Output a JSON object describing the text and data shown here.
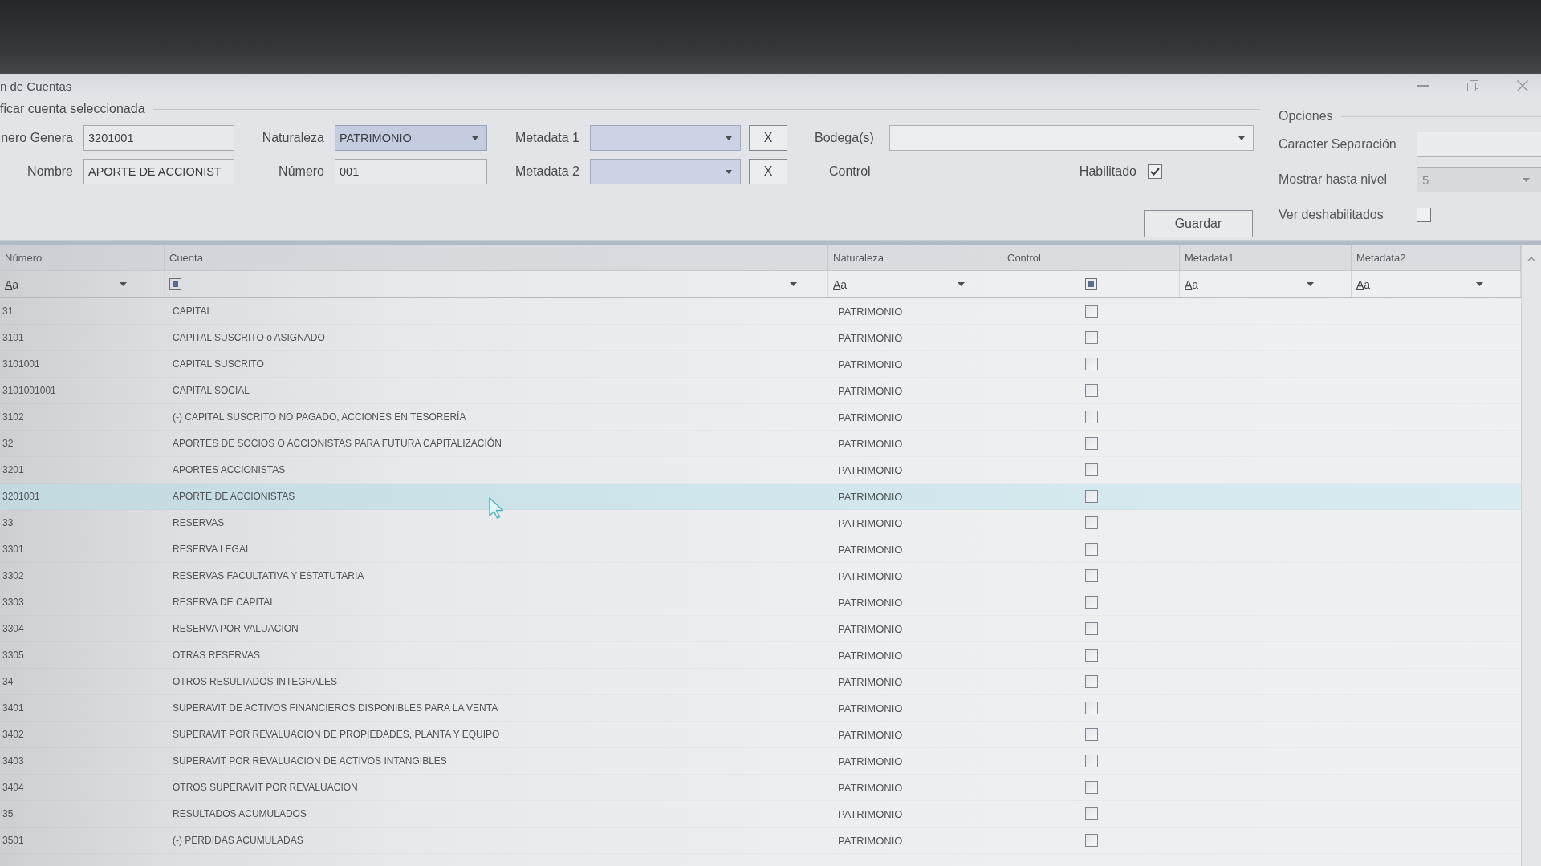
{
  "window": {
    "title": "n de Cuentas"
  },
  "form": {
    "title": "ficar cuenta seleccionada",
    "numero_general": {
      "label": "nero Genera",
      "value": "3201001"
    },
    "naturaleza": {
      "label": "Naturaleza",
      "value": "PATRIMONIO"
    },
    "metadata_1": {
      "label": "Metadata 1",
      "clear_button": "X"
    },
    "bodegas": {
      "label": "Bodega(s)"
    },
    "nombre": {
      "label": "Nombre",
      "value": "APORTE DE ACCIONIST"
    },
    "numero": {
      "label": "Número",
      "value": "001"
    },
    "metadata_2": {
      "label": "Metadata 2",
      "clear_button": "X"
    },
    "control": {
      "label": "Control"
    },
    "habilitado": {
      "label": "Habilitado",
      "checked": true
    },
    "save_button": "Guardar"
  },
  "options": {
    "title": "Opciones",
    "caracter_separacion": {
      "label": "Caracter Separación"
    },
    "mostrar_hasta_nivel": {
      "label": "Mostrar hasta nivel",
      "value": "5"
    },
    "ver_deshabilitados": {
      "label": "Ver deshabilitados",
      "checked": false
    }
  },
  "grid": {
    "columns": [
      {
        "label": "Número",
        "filter": {
          "kind": "text",
          "text": "Aa"
        }
      },
      {
        "label": "Cuenta",
        "filter": {
          "kind": "checkbox",
          "indeterminate": true,
          "dropdown": true
        }
      },
      {
        "label": "Naturaleza",
        "filter": {
          "kind": "text",
          "text": "Aa"
        }
      },
      {
        "label": "Control",
        "filter": {
          "kind": "checkbox",
          "indeterminate": true,
          "dropdown": false
        }
      },
      {
        "label": "Metadata1",
        "filter": {
          "kind": "text",
          "text": "Aa"
        }
      },
      {
        "label": "Metadata2",
        "filter": {
          "kind": "text",
          "text": "Aa"
        }
      }
    ],
    "rows": [
      {
        "numero": "31",
        "cuenta": "CAPITAL",
        "naturaleza": "PATRIMONIO",
        "control": false,
        "selected": false
      },
      {
        "numero": "3101",
        "cuenta": "CAPITAL SUSCRITO o ASIGNADO",
        "naturaleza": "PATRIMONIO",
        "control": false,
        "selected": false
      },
      {
        "numero": "3101001",
        "cuenta": "CAPITAL SUSCRITO",
        "naturaleza": "PATRIMONIO",
        "control": false,
        "selected": false
      },
      {
        "numero": "3101001001",
        "cuenta": "CAPITAL SOCIAL",
        "naturaleza": "PATRIMONIO",
        "control": false,
        "selected": false
      },
      {
        "numero": "3102",
        "cuenta": "(-) CAPITAL SUSCRITO NO PAGADO, ACCIONES EN TESORERÍA",
        "naturaleza": "PATRIMONIO",
        "control": false,
        "selected": false
      },
      {
        "numero": "32",
        "cuenta": "APORTES DE SOCIOS O ACCIONISTAS PARA FUTURA CAPITALIZACIÓN",
        "naturaleza": "PATRIMONIO",
        "control": false,
        "selected": false
      },
      {
        "numero": "3201",
        "cuenta": "APORTES ACCIONISTAS",
        "naturaleza": "PATRIMONIO",
        "control": false,
        "selected": false
      },
      {
        "numero": "3201001",
        "cuenta": "APORTE DE ACCIONISTAS",
        "naturaleza": "PATRIMONIO",
        "control": false,
        "selected": true
      },
      {
        "numero": "33",
        "cuenta": "RESERVAS",
        "naturaleza": "PATRIMONIO",
        "control": false,
        "selected": false
      },
      {
        "numero": "3301",
        "cuenta": "RESERVA LEGAL",
        "naturaleza": "PATRIMONIO",
        "control": false,
        "selected": false
      },
      {
        "numero": "3302",
        "cuenta": "RESERVAS FACULTATIVA Y ESTATUTARIA",
        "naturaleza": "PATRIMONIO",
        "control": false,
        "selected": false
      },
      {
        "numero": "3303",
        "cuenta": "RESERVA DE CAPITAL",
        "naturaleza": "PATRIMONIO",
        "control": false,
        "selected": false
      },
      {
        "numero": "3304",
        "cuenta": "RESERVA POR VALUACION",
        "naturaleza": "PATRIMONIO",
        "control": false,
        "selected": false
      },
      {
        "numero": "3305",
        "cuenta": "OTRAS RESERVAS",
        "naturaleza": "PATRIMONIO",
        "control": false,
        "selected": false
      },
      {
        "numero": "34",
        "cuenta": "OTROS RESULTADOS INTEGRALES",
        "naturaleza": "PATRIMONIO",
        "control": false,
        "selected": false
      },
      {
        "numero": "3401",
        "cuenta": "SUPERAVIT DE ACTIVOS FINANCIEROS DISPONIBLES PARA LA VENTA",
        "naturaleza": "PATRIMONIO",
        "control": false,
        "selected": false
      },
      {
        "numero": "3402",
        "cuenta": "SUPERAVIT POR REVALUACION DE PROPIEDADES, PLANTA Y EQUIPO",
        "naturaleza": "PATRIMONIO",
        "control": false,
        "selected": false
      },
      {
        "numero": "3403",
        "cuenta": "SUPERAVIT POR REVALUACION DE ACTIVOS INTANGIBLES",
        "naturaleza": "PATRIMONIO",
        "control": false,
        "selected": false
      },
      {
        "numero": "3404",
        "cuenta": "OTROS SUPERAVIT POR REVALUACION",
        "naturaleza": "PATRIMONIO",
        "control": false,
        "selected": false
      },
      {
        "numero": "35",
        "cuenta": "RESULTADOS ACUMULADOS",
        "naturaleza": "PATRIMONIO",
        "control": false,
        "selected": false
      },
      {
        "numero": "3501",
        "cuenta": "(-) PERDIDAS ACUMULADAS",
        "naturaleza": "PATRIMONIO",
        "control": false,
        "selected": false
      }
    ]
  }
}
